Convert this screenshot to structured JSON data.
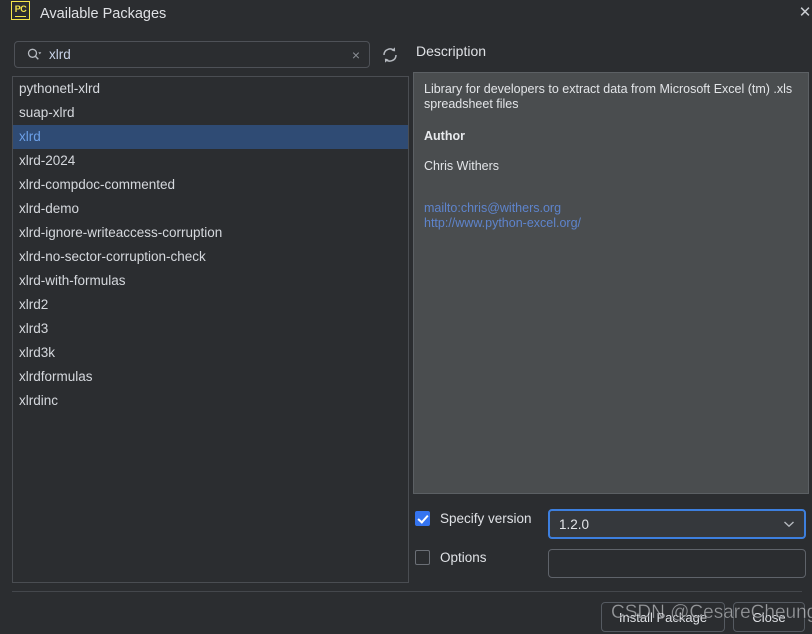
{
  "window": {
    "title": "Available Packages",
    "logo_text": "PC",
    "logo_icon": "pycharm-logo-icon",
    "close_icon": "window-close-icon"
  },
  "search": {
    "value": "xlrd",
    "placeholder": "",
    "search_icon": "search-dropdown-icon",
    "clear_icon": "clear-icon",
    "clear_glyph": "×",
    "refresh_icon": "refresh-icon"
  },
  "package_list": {
    "selected": "xlrd",
    "items": [
      "pythonetl-xlrd",
      "suap-xlrd",
      "xlrd",
      "xlrd-2024",
      "xlrd-compdoc-commented",
      "xlrd-demo",
      "xlrd-ignore-writeaccess-corruption",
      "xlrd-no-sector-corruption-check",
      "xlrd-with-formulas",
      "xlrd2",
      "xlrd3",
      "xlrd3k",
      "xlrdformulas",
      "xlrdinc"
    ]
  },
  "description": {
    "label": "Description",
    "summary": "Library for developers to extract data from Microsoft Excel (tm) .xls spreadsheet files",
    "author_heading": "Author",
    "author_name": "Chris Withers",
    "links": [
      "mailto:chris@withers.org",
      "http://www.python-excel.org/"
    ]
  },
  "options": {
    "specify_version_label": "Specify version",
    "specify_version_checked": true,
    "version_value": "1.2.0",
    "version_dropdown_icon": "chevron-down-icon",
    "options_label": "Options",
    "options_checked": false,
    "options_value": "",
    "options_placeholder": ""
  },
  "footer": {
    "install_label": "Install Package",
    "close_label": "Close"
  },
  "watermark": {
    "text": "CSDN @CesareCheung"
  },
  "colors": {
    "background": "#2b2d30",
    "selection": "#2f4b74",
    "selection_text": "#6ca0e8",
    "accent_blue": "#3574f0",
    "focus_ring": "#3d7fde",
    "link": "#5e84cc",
    "desc_panel": "#4a4d4f",
    "logo_yellow": "#f5e64a"
  }
}
